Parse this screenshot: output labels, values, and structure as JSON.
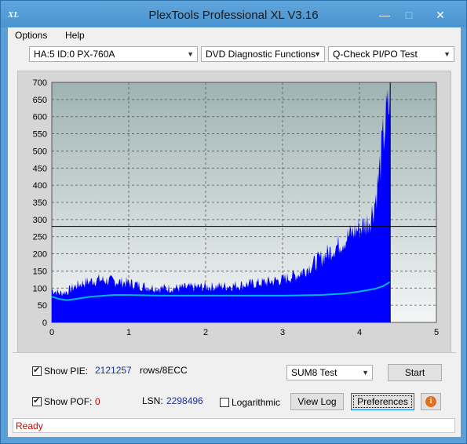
{
  "window": {
    "title": "PlexTools Professional XL V3.16",
    "icon_text": "XL"
  },
  "menu": {
    "items": [
      "Options",
      "Help"
    ]
  },
  "toolbar": {
    "drive": "HA:5 ID:0  PX-760A",
    "function": "DVD Diagnostic Functions",
    "test": "Q-Check PI/PO Test"
  },
  "chart_data": {
    "type": "area",
    "x_ticks": [
      "0",
      "1",
      "2",
      "3",
      "4",
      "5"
    ],
    "y_ticks": [
      "0",
      "50",
      "100",
      "150",
      "200",
      "250",
      "300",
      "350",
      "400",
      "450",
      "500",
      "550",
      "600",
      "650",
      "700"
    ],
    "xlim": [
      0,
      5
    ],
    "ylim": [
      0,
      700
    ],
    "grid": true,
    "threshold": 280,
    "end_marker_x": 4.4,
    "series": [
      {
        "color": "#0000ff",
        "x": [
          0,
          0.1,
          0.2,
          0.3,
          0.4,
          0.5,
          0.6,
          0.8,
          1.0,
          1.2,
          1.4,
          1.6,
          1.8,
          2.0,
          2.2,
          2.4,
          2.6,
          2.8,
          3.0,
          3.2,
          3.4,
          3.6,
          3.8,
          3.9,
          4.0,
          4.1,
          4.15,
          4.2,
          4.25,
          4.3,
          4.35,
          4.4
        ],
        "y": [
          95,
          85,
          90,
          105,
          115,
          120,
          125,
          120,
          115,
          105,
          100,
          100,
          102,
          104,
          105,
          108,
          112,
          118,
          125,
          140,
          170,
          205,
          240,
          260,
          275,
          290,
          310,
          350,
          420,
          520,
          600,
          640
        ]
      },
      {
        "color": "#00b4e6",
        "x": [
          0,
          0.1,
          0.2,
          0.3,
          0.5,
          0.8,
          1.0,
          1.4,
          2.0,
          2.5,
          3.0,
          3.5,
          3.8,
          4.0,
          4.2,
          4.3,
          4.4
        ],
        "y": [
          75,
          68,
          65,
          68,
          75,
          80,
          80,
          78,
          78,
          78,
          78,
          80,
          84,
          90,
          98,
          105,
          118
        ]
      }
    ]
  },
  "controls": {
    "show_pie_label": "Show PIE:",
    "pie_value": "2121257",
    "pie_unit": "rows/8ECC",
    "show_pof_label": "Show POF:",
    "pof_value": "0",
    "lsn_label": "LSN:",
    "lsn_value": "2298496",
    "logarithmic_label": "Logarithmic",
    "sum_select": "SUM8 Test",
    "start_button": "Start",
    "view_log_button": "View Log",
    "preferences_button": "Preferences",
    "info_icon": "i"
  },
  "status": {
    "text": "Ready"
  }
}
